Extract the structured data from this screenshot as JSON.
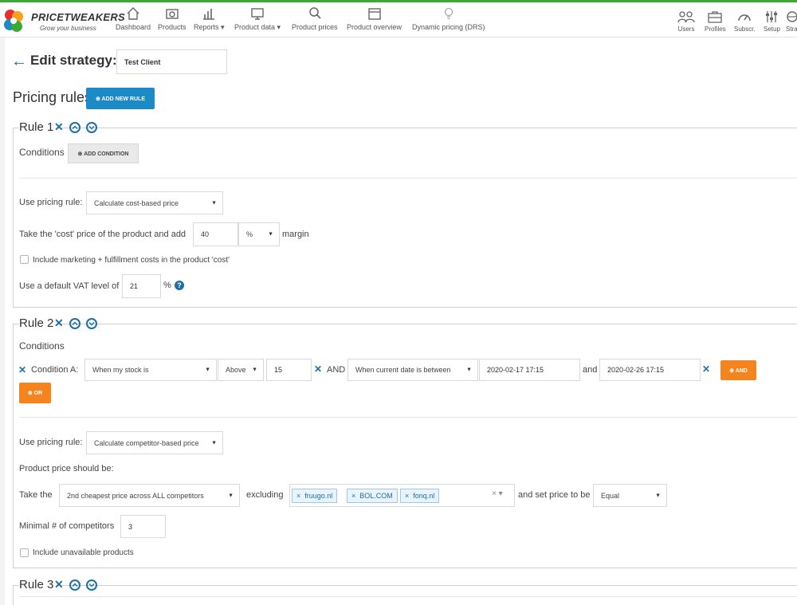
{
  "brand": {
    "name": "PRICETWEAKERS",
    "tagline": "Grow your business"
  },
  "nav": [
    {
      "label": "Dashboard",
      "icon": "home-icon"
    },
    {
      "label": "Products",
      "icon": "camera-icon"
    },
    {
      "label": "Reports ▾",
      "icon": "bar-chart-icon"
    },
    {
      "label": "Product data ▾",
      "icon": "monitor-icon"
    },
    {
      "label": "Product prices",
      "icon": "search-icon"
    },
    {
      "label": "Product overview",
      "icon": "calendar-icon"
    },
    {
      "label": "Dynamic pricing (DRS)",
      "icon": "bulb-icon"
    }
  ],
  "right_nav": [
    {
      "label": "Users",
      "icon": "users-icon"
    },
    {
      "label": "Profiles",
      "icon": "briefcase-icon"
    },
    {
      "label": "Subscr.",
      "icon": "speedometer-icon"
    },
    {
      "label": "Setup",
      "icon": "sliders-icon"
    },
    {
      "label": "Stra",
      "icon": "globe-icon"
    }
  ],
  "header": {
    "title": "Edit strategy:",
    "client_value": "Test Client"
  },
  "pricing": {
    "title": "Pricing rules",
    "add_rule": "⊕ ADD NEW RULE"
  },
  "rule1": {
    "label": "Rule 1",
    "conditions_label": "Conditions",
    "add_condition": "⊕ ADD CONDITION",
    "use_rule_label": "Use pricing rule:",
    "use_rule_value": "Calculate cost-based price",
    "take_cost_label": "Take the 'cost' price of the product and add",
    "margin_value": "40",
    "margin_unit": "%",
    "margin_suffix": "margin",
    "include_costs_label": "Include marketing + fulfillment costs in the product 'cost'",
    "vat_label": "Use a default VAT level of",
    "vat_value": "21",
    "vat_unit": "%"
  },
  "rule2": {
    "label": "Rule 2",
    "conditions_label": "Conditions",
    "condition_a_label": "Condition A:",
    "cond1_field": "When my stock is",
    "cond1_op": "Above",
    "cond1_value": "15",
    "and_label": "AND",
    "cond2_field": "When current date is between",
    "date_from": "2020-02-17 17:15",
    "and_word": "and",
    "date_to": "2020-02-26 17:15",
    "and_button": "⊕ AND",
    "or_button": "⊕ OR",
    "use_rule_label": "Use pricing rule:",
    "use_rule_value": "Calculate competitor-based price",
    "product_price_label": "Product price should be:",
    "take_the_label": "Take the",
    "take_the_value": "2nd cheapest price across ALL competitors",
    "excluding_label": "excluding",
    "excluded": [
      "fruugo.nl",
      "BOL.COM",
      "fonq.nl"
    ],
    "set_price_label": "and set price to be",
    "set_price_value": "Equal",
    "min_competitors_label": "Minimal # of competitors",
    "min_competitors_value": "3",
    "include_unavailable_label": "Include unavailable products"
  },
  "rule3": {
    "label": "Rule 3"
  },
  "colors": {
    "accent": "#1d6fa5",
    "button_blue": "#1d8ac8",
    "button_orange": "#f5841f",
    "top_line": "#3aa935"
  }
}
